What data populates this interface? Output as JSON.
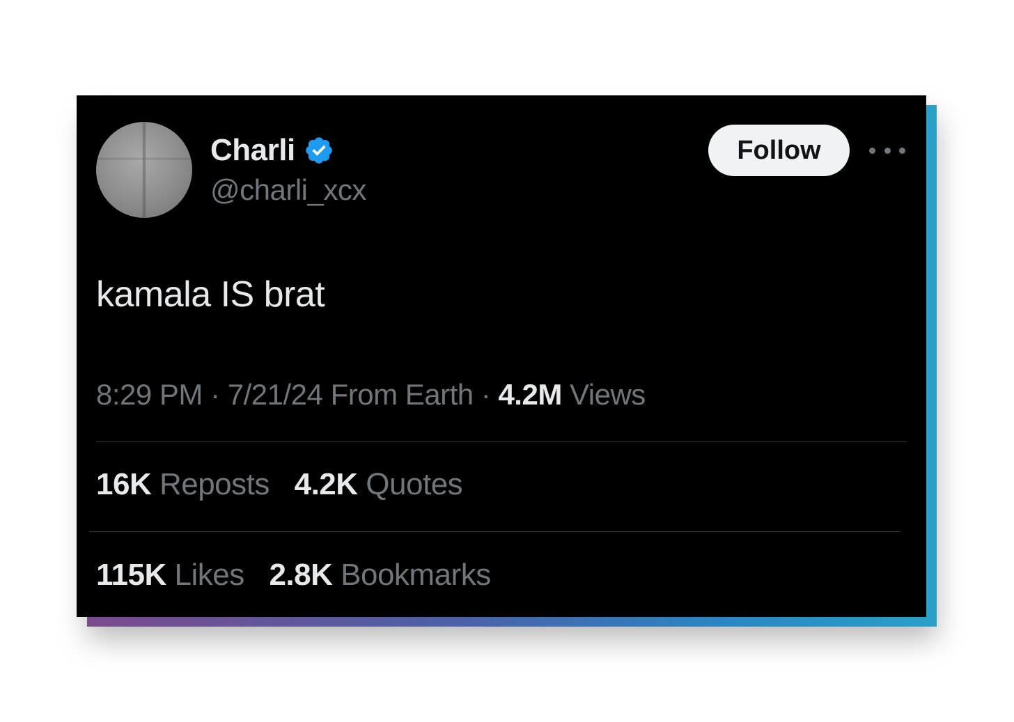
{
  "tweet": {
    "author": {
      "display_name": "Charli",
      "handle": "@charli_xcx",
      "verified": true,
      "avatar_icon": "avatar-image"
    },
    "follow_label": "Follow",
    "more_icon": "more-dots-icon",
    "text": "kamala IS brat",
    "meta": {
      "time": "8:29 PM",
      "separator": "·",
      "date_location": "7/21/24 From Earth",
      "views_count": "4.2M",
      "views_label": "Views"
    },
    "stats": {
      "reposts_count": "16K",
      "reposts_label": "Reposts",
      "quotes_count": "4.2K",
      "quotes_label": "Quotes",
      "likes_count": "115K",
      "likes_label": "Likes",
      "bookmarks_count": "2.8K",
      "bookmarks_label": "Bookmarks"
    }
  },
  "colors": {
    "background": "#000000",
    "primary_text": "#e7e9ea",
    "secondary_text": "#71767b",
    "verified_badge": "#1d9bf0",
    "follow_button_bg": "#eff3f4",
    "divider": "#2f3336"
  }
}
